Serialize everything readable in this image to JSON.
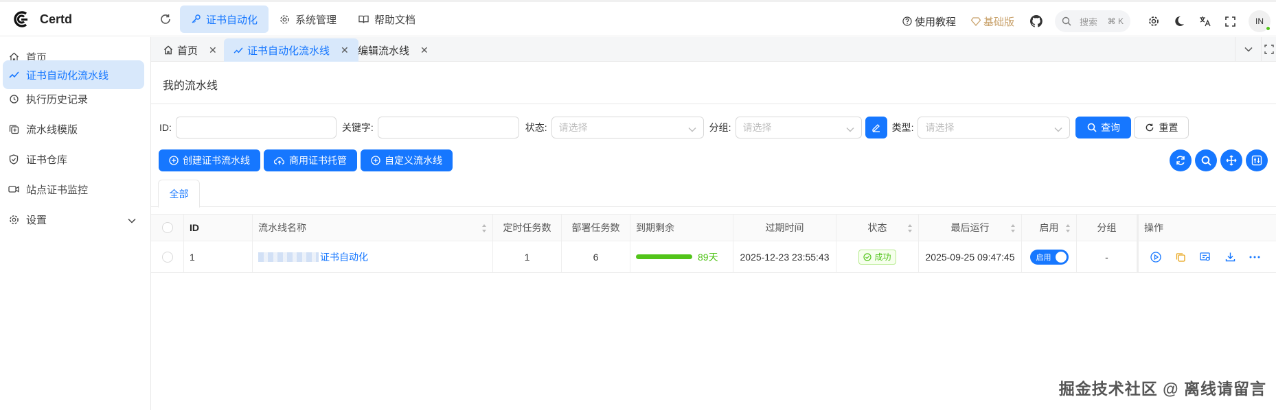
{
  "header": {
    "logo_text": "Certd",
    "nav": [
      {
        "label": "证书自动化",
        "active": true
      },
      {
        "label": "系统管理",
        "active": false
      },
      {
        "label": "帮助文档",
        "active": false
      }
    ],
    "tutorial": "使用教程",
    "edition": "基础版",
    "search_placeholder": "搜索",
    "search_shortcut": "⌘ K",
    "avatar_initials": "IN"
  },
  "sidebar": {
    "items": [
      {
        "label": "首页",
        "icon": "home-icon"
      },
      {
        "label": "证书自动化流水线",
        "icon": "trend-icon",
        "active": true
      },
      {
        "label": "执行历史记录",
        "icon": "history-icon"
      },
      {
        "label": "流水线模版",
        "icon": "template-icon"
      },
      {
        "label": "证书仓库",
        "icon": "shield-icon"
      },
      {
        "label": "站点证书监控",
        "icon": "camera-icon"
      },
      {
        "label": "设置",
        "icon": "gear-icon"
      }
    ]
  },
  "tabs": [
    {
      "label": "首页"
    },
    {
      "label": "证书自动化流水线",
      "active": true
    },
    {
      "label": "编辑流水线"
    }
  ],
  "page": {
    "title": "我的流水线"
  },
  "filters": {
    "id_label": "ID",
    "keyword_label": "关键字",
    "status_label": "状态",
    "status_placeholder": "请选择",
    "group_label": "分组",
    "group_placeholder": "请选择",
    "type_label": "类型",
    "type_placeholder": "请选择",
    "query_button": "查询",
    "reset_button": "重置"
  },
  "actions": {
    "create": "创建证书流水线",
    "commercial": "商用证书托管",
    "custom": "自定义流水线"
  },
  "subtabs": {
    "all": "全部"
  },
  "table": {
    "headers": {
      "id": "ID",
      "name": "流水线名称",
      "timer_tasks": "定时任务数",
      "deploy_tasks": "部署任务数",
      "remaining": "到期剩余",
      "expire_time": "过期时间",
      "status": "状态",
      "last_run": "最后运行",
      "enabled": "启用",
      "group": "分组",
      "ops": "操作"
    },
    "rows": [
      {
        "id": "1",
        "name_suffix": "证书自动化",
        "timer_tasks": "1",
        "deploy_tasks": "6",
        "remaining_days": "89天",
        "expire_time": "2025-12-23 23:55:43",
        "status": "成功",
        "last_run": "2025-09-25 09:47:45",
        "enabled_label": "启用",
        "group": "-"
      }
    ]
  },
  "watermark": "掘金技术社区 @ 离线请留言",
  "colors": {
    "primary": "#1677ff",
    "success": "#52c41a",
    "active_bg": "#d8e8fb",
    "edition": "#c8a16a"
  }
}
